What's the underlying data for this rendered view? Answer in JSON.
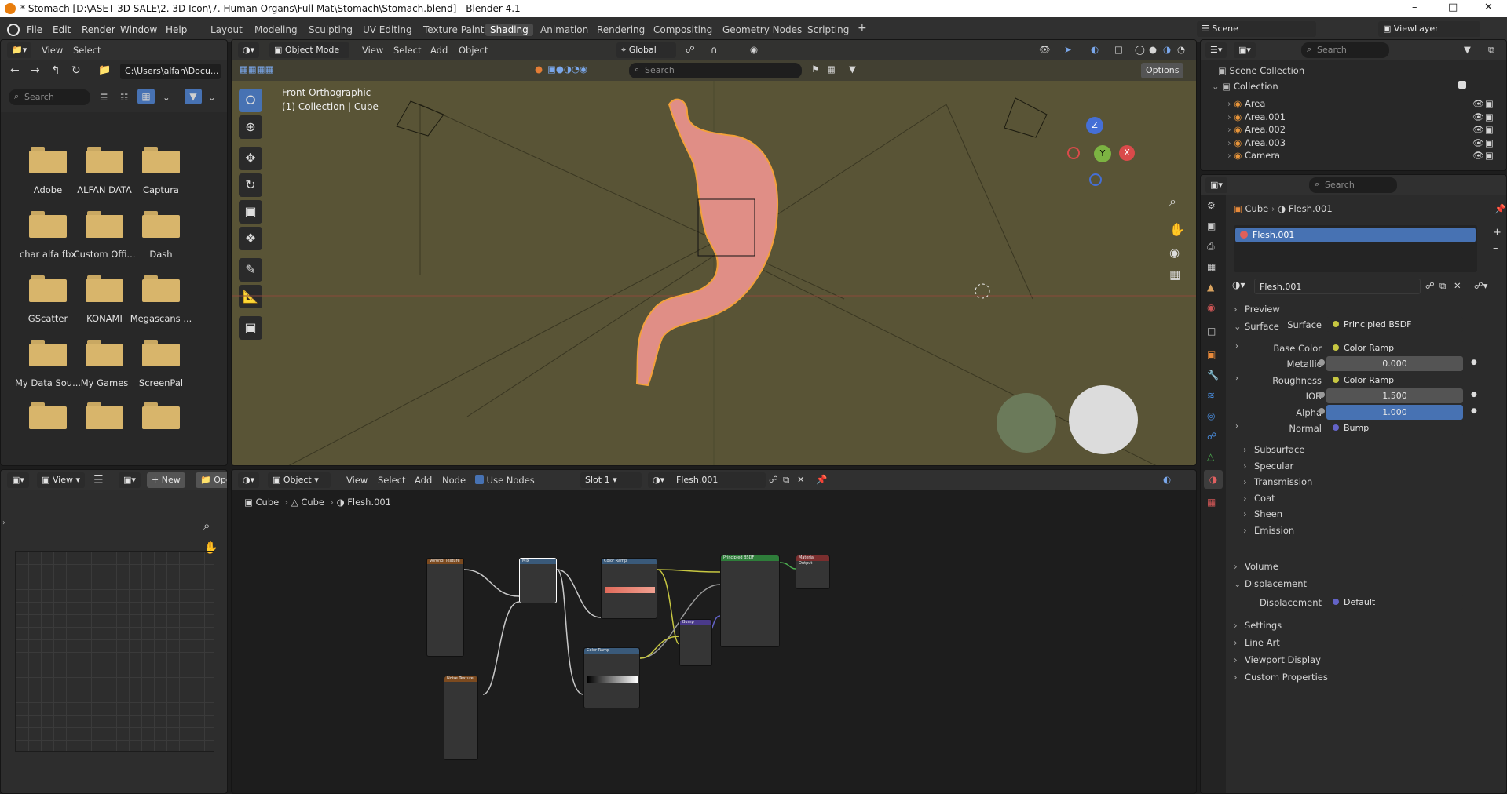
{
  "window": {
    "title": "* Stomach [D:\\ASET 3D SALE\\2. 3D Icon\\7. Human Organs\\Full Mat\\Stomach\\Stomach.blend] - Blender 4.1"
  },
  "menubar": {
    "items": [
      "File",
      "Edit",
      "Render",
      "Window",
      "Help"
    ]
  },
  "workspaces": {
    "tabs": [
      "Layout",
      "Modeling",
      "Sculpting",
      "UV Editing",
      "Texture Paint",
      "Shading",
      "Animation",
      "Rendering",
      "Compositing",
      "Geometry Nodes",
      "Scripting"
    ],
    "active": "Shading"
  },
  "scene": {
    "name": "Scene",
    "view_layer": "ViewLayer"
  },
  "filebrowser": {
    "menu": [
      "View",
      "Select"
    ],
    "path": "C:\\Users\\alfan\\Docu...",
    "search_placeholder": "Search",
    "folders": [
      "Adobe",
      "ALFAN DATA",
      "Captura",
      "char alfa fbx",
      "Custom Offi...",
      "Dash",
      "GScatter",
      "KONAMI",
      "Megascans ...",
      "My Data Sou...",
      "My Games",
      "ScreenPal",
      "",
      "",
      ""
    ]
  },
  "viewport": {
    "mode": "Object Mode",
    "menu": [
      "View",
      "Select",
      "Add",
      "Object"
    ],
    "orientation": "Global",
    "search_placeholder": "Search",
    "options": "Options",
    "view_name": "Front Orthographic",
    "collection_info": "(1) Collection | Cube",
    "axes": {
      "z": "Z",
      "y": "Y",
      "x": "X"
    }
  },
  "image_editor": {
    "view": "View",
    "new_label": "New",
    "open_label": "Ope"
  },
  "node_editor": {
    "mode": "Object",
    "menu": [
      "View",
      "Select",
      "Add",
      "Node"
    ],
    "use_nodes": "Use Nodes",
    "slot": "Slot 1",
    "material": "Flesh.001",
    "breadcrumb": [
      "Cube",
      "Cube",
      "Flesh.001"
    ],
    "nodes": {
      "voronoi": "Voronoi Texture",
      "mix": "Mix",
      "color_ramp1": "Color Ramp",
      "principled": "Principled BSDF",
      "material_output": "Material Output",
      "color_ramp2": "Color Ramp",
      "bump": "Bump",
      "noise": "Noise Texture"
    }
  },
  "outliner": {
    "search_placeholder": "Search",
    "root": "Scene Collection",
    "collection": "Collection",
    "items": [
      "Area",
      "Area.001",
      "Area.002",
      "Area.003",
      "Camera"
    ]
  },
  "properties": {
    "search_placeholder": "Search",
    "breadcrumb": [
      "Cube",
      "Flesh.001"
    ],
    "slot_item": "Flesh.001",
    "material_name": "Flesh.001",
    "sections_top": [
      "Preview",
      "Surface"
    ],
    "rows": [
      {
        "k": "Surface",
        "v": "Principled BSDF"
      },
      {
        "k": "Base Color",
        "v": "Color Ramp"
      },
      {
        "k": "Metallic",
        "v": "0.000"
      },
      {
        "k": "Roughness",
        "v": "Color Ramp"
      },
      {
        "k": "IOR",
        "v": "1.500"
      },
      {
        "k": "Alpha",
        "v": "1.000"
      },
      {
        "k": "Normal",
        "v": "Bump"
      }
    ],
    "subsections": [
      "Subsurface",
      "Specular",
      "Transmission",
      "Coat",
      "Sheen",
      "Emission"
    ],
    "volume": "Volume",
    "displacement_section": "Displacement",
    "displacement_label": "Displacement",
    "displacement_value": "Default",
    "bottom": [
      "Settings",
      "Line Art",
      "Viewport Display",
      "Custom Properties"
    ]
  },
  "colors": {
    "accent": "#4772b3",
    "viewport_bg": "#595436",
    "selection_outline": "#f0a030"
  }
}
